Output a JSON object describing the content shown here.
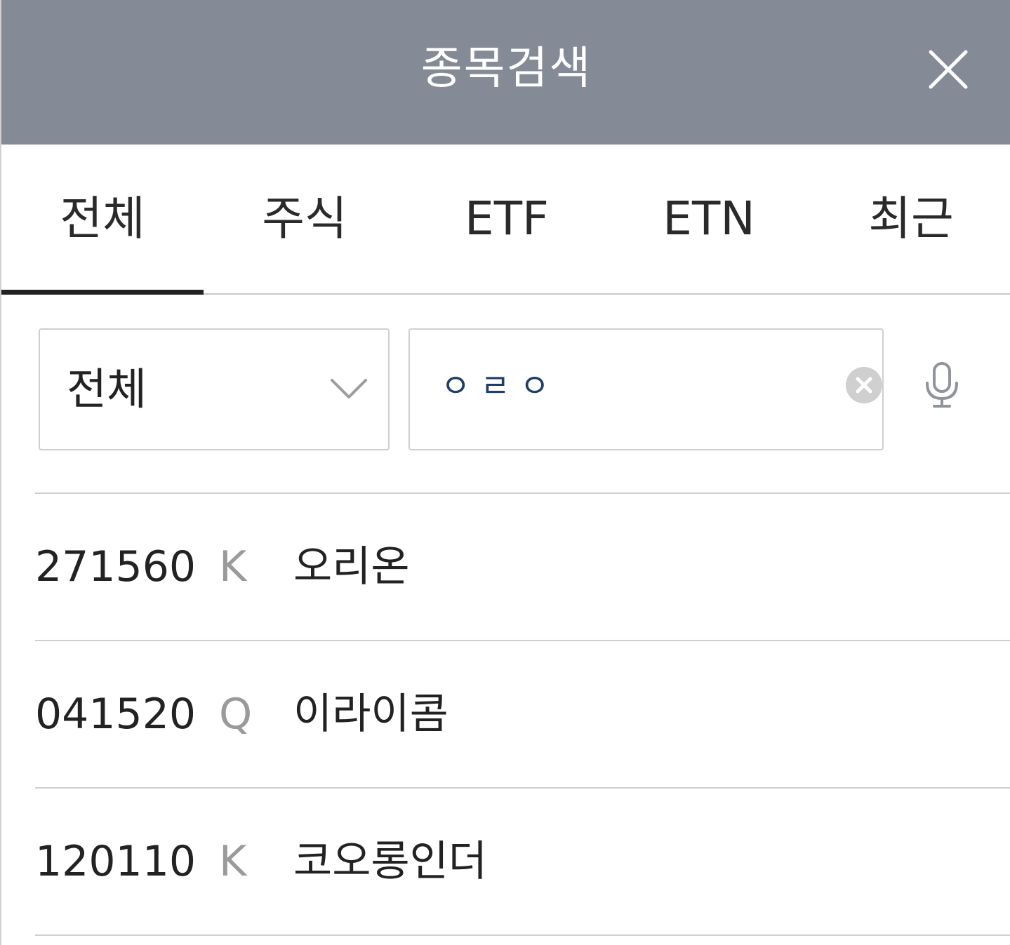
{
  "header": {
    "title": "종목검색"
  },
  "tabs": [
    {
      "label": "전체",
      "active": true
    },
    {
      "label": "주식",
      "active": false
    },
    {
      "label": "ETF",
      "active": false
    },
    {
      "label": "ETN",
      "active": false
    },
    {
      "label": "최근",
      "active": false
    }
  ],
  "filter": {
    "selected": "전체",
    "icon": "chevron-down-icon"
  },
  "search": {
    "value": "ㅇㄹㅇ",
    "clear_icon": "clear-circle-icon",
    "mic_icon": "microphone-icon"
  },
  "results": [
    {
      "code": "271560",
      "market": "K",
      "name": "오리온"
    },
    {
      "code": "041520",
      "market": "Q",
      "name": "이라이콤"
    },
    {
      "code": "120110",
      "market": "K",
      "name": "코오롱인더"
    }
  ],
  "colors": {
    "header_bg": "#848a96",
    "search_text": "#1f3f66",
    "market_text": "#9a9a9a"
  }
}
